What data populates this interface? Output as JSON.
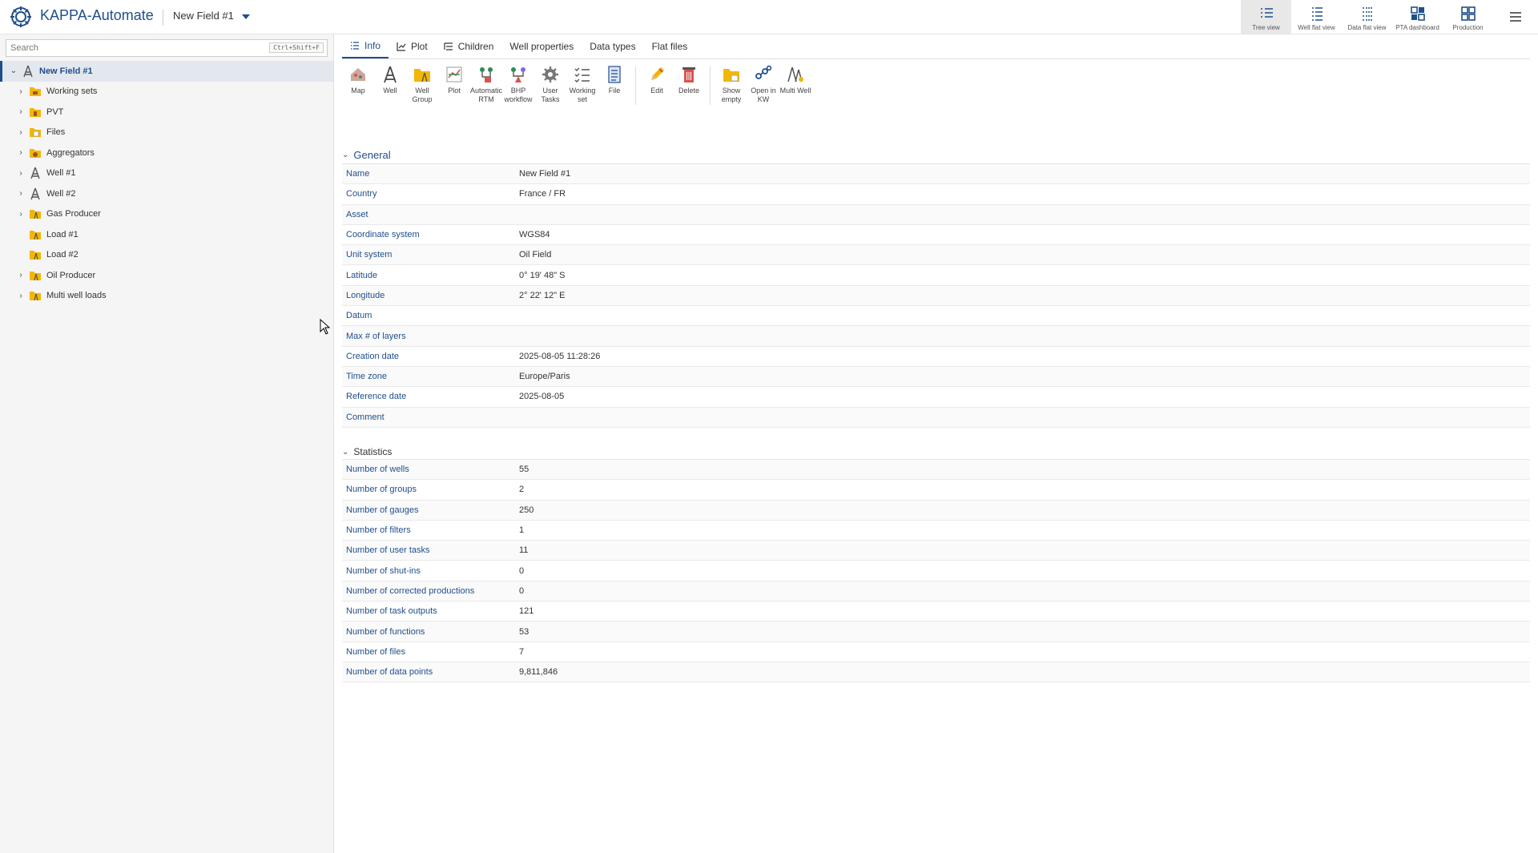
{
  "app": {
    "title": "KAPPA-Automate",
    "field_selector": "New Field #1"
  },
  "views": [
    {
      "label": "Tree view",
      "icon": "tree-view-icon",
      "active": true
    },
    {
      "label": "Well flat view",
      "icon": "well-flat-view-icon",
      "active": false
    },
    {
      "label": "Data flat view",
      "icon": "data-flat-view-icon",
      "active": false
    },
    {
      "label": "PTA dashboard",
      "icon": "pta-dashboard-icon",
      "active": false
    },
    {
      "label": "Production",
      "icon": "production-icon",
      "active": false
    }
  ],
  "search": {
    "placeholder": "Search",
    "shortcut": "Ctrl+Shift+F"
  },
  "tree": {
    "root": {
      "label": "New Field #1",
      "icon": "field-icon"
    },
    "items": [
      {
        "label": "Working sets",
        "icon": "working-sets-folder-icon",
        "expandable": true
      },
      {
        "label": "PVT",
        "icon": "pvt-folder-icon",
        "expandable": true
      },
      {
        "label": "Files",
        "icon": "files-folder-icon",
        "expandable": true
      },
      {
        "label": "Aggregators",
        "icon": "aggregators-folder-icon",
        "expandable": true
      },
      {
        "label": "Well #1",
        "icon": "well-icon",
        "expandable": true
      },
      {
        "label": "Well #2",
        "icon": "well-icon",
        "expandable": true
      },
      {
        "label": "Gas Producer",
        "icon": "well-group-folder-icon",
        "expandable": true
      },
      {
        "label": "Load #1",
        "icon": "well-group-folder-icon",
        "expandable": false
      },
      {
        "label": "Load #2",
        "icon": "well-group-folder-icon",
        "expandable": false
      },
      {
        "label": "Oil Producer",
        "icon": "well-group-folder-icon",
        "expandable": true
      },
      {
        "label": "Multi well loads",
        "icon": "well-group-folder-icon",
        "expandable": true
      }
    ]
  },
  "tabs": [
    {
      "label": "Info",
      "icon": "list-icon",
      "active": true
    },
    {
      "label": "Plot",
      "icon": "chart-icon",
      "active": false
    },
    {
      "label": "Children",
      "icon": "children-icon",
      "active": false
    },
    {
      "label": "Well properties",
      "active": false
    },
    {
      "label": "Data types",
      "active": false
    },
    {
      "label": "Flat files",
      "active": false
    }
  ],
  "toolbar": {
    "map": "Map",
    "well": "Well",
    "well_group": "Well Group",
    "plot": "Plot",
    "automatic_rtm": "Automatic RTM",
    "bhp_workflow": "BHP workflow",
    "user_tasks": "User Tasks",
    "working_set": "Working set",
    "file": "File",
    "edit": "Edit",
    "delete": "Delete",
    "show_empty": "Show empty",
    "open_in_kw": "Open in KW",
    "multi_well": "Multi Well"
  },
  "general": {
    "title": "General",
    "rows": [
      {
        "key": "Name",
        "value": "New Field #1"
      },
      {
        "key": "Country",
        "value": "France / FR"
      },
      {
        "key": "Asset",
        "value": ""
      },
      {
        "key": "Coordinate system",
        "value": "WGS84"
      },
      {
        "key": "Unit system",
        "value": "Oil Field"
      },
      {
        "key": "Latitude",
        "value": "0° 19' 48\" S"
      },
      {
        "key": "Longitude",
        "value": "2° 22' 12\" E"
      },
      {
        "key": "Datum",
        "value": ""
      },
      {
        "key": "Max # of layers",
        "value": ""
      },
      {
        "key": "Creation date",
        "value": "2025-08-05 11:28:26"
      },
      {
        "key": "Time zone",
        "value": "Europe/Paris"
      },
      {
        "key": "Reference date",
        "value": "2025-08-05"
      },
      {
        "key": "Comment",
        "value": ""
      }
    ]
  },
  "statistics": {
    "title": "Statistics",
    "rows": [
      {
        "key": "Number of wells",
        "value": "55"
      },
      {
        "key": "Number of groups",
        "value": "2"
      },
      {
        "key": "Number of gauges",
        "value": "250"
      },
      {
        "key": "Number of filters",
        "value": "1"
      },
      {
        "key": "Number of user tasks",
        "value": "11"
      },
      {
        "key": "Number of shut-ins",
        "value": "0"
      },
      {
        "key": "Number of corrected productions",
        "value": "0"
      },
      {
        "key": "Number of task outputs",
        "value": "121"
      },
      {
        "key": "Number of functions",
        "value": "53"
      },
      {
        "key": "Number of files",
        "value": "7"
      },
      {
        "key": "Number of data points",
        "value": "9,811,846"
      }
    ]
  },
  "colors": {
    "accent": "#1f4e8c",
    "folder": "#f2b705",
    "red": "#d9534f"
  }
}
